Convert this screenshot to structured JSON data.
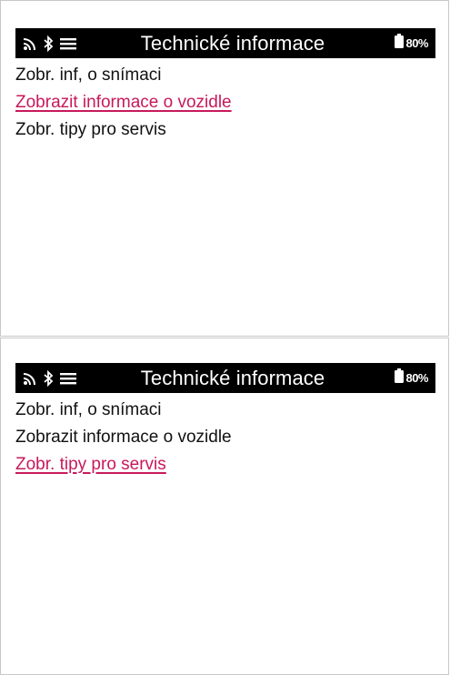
{
  "screens": [
    {
      "status": {
        "icons": [
          "wireless-icon",
          "bluetooth-icon",
          "menu-icon"
        ],
        "title": "Technické informace",
        "battery_icon": "battery-icon",
        "battery_level": "80%"
      },
      "menu": [
        {
          "label": "Zobr. inf, o snímaci",
          "selected": false
        },
        {
          "label": "Zobrazit informace o vozidle",
          "selected": true
        },
        {
          "label": "Zobr. tipy pro servis",
          "selected": false
        }
      ]
    },
    {
      "status": {
        "icons": [
          "wireless-icon",
          "bluetooth-icon",
          "menu-icon"
        ],
        "title": "Technické informace",
        "battery_icon": "battery-icon",
        "battery_level": "80%"
      },
      "menu": [
        {
          "label": "Zobr. inf, o snímaci",
          "selected": false
        },
        {
          "label": "Zobrazit informace o vozidle",
          "selected": false
        },
        {
          "label": "Zobr. tipy pro servis",
          "selected": true
        }
      ]
    }
  ],
  "colors": {
    "statusbar_bg": "#000000",
    "selected_text": "#c8195a",
    "normal_text": "#111111"
  }
}
